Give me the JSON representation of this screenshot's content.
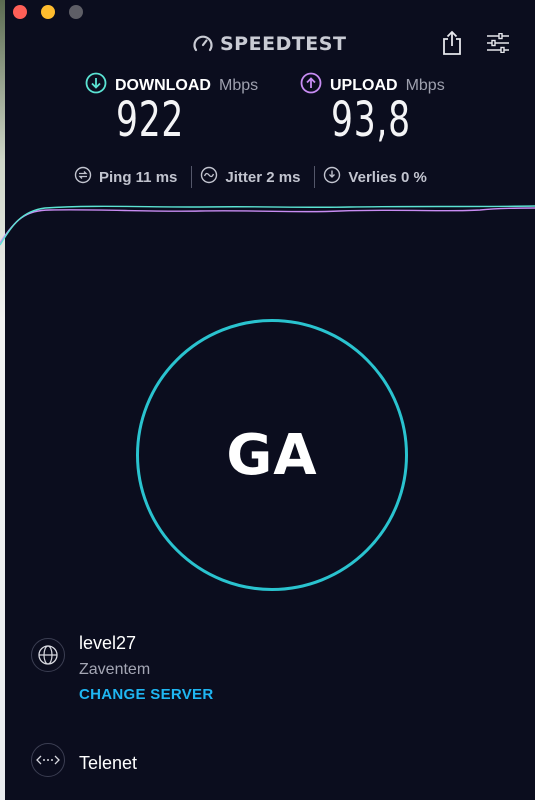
{
  "window": {
    "traffic_lights": [
      "close",
      "minimize",
      "maximize"
    ]
  },
  "header": {
    "logo_text": "SPEEDTEST",
    "logo_icon": "gauge-icon",
    "share_icon": "share-icon",
    "settings_icon": "sliders-icon"
  },
  "download": {
    "label": "DOWNLOAD",
    "unit": "Mbps",
    "value": "922",
    "icon": "arrow-down-circle-icon",
    "color": "#5be3d3"
  },
  "upload": {
    "label": "UPLOAD",
    "unit": "Mbps",
    "value": "93,8",
    "icon": "arrow-up-circle-icon",
    "color": "#c88cf3"
  },
  "stats": {
    "ping": "Ping 11 ms",
    "jitter": "Jitter 2 ms",
    "loss": "Verlies 0 %"
  },
  "go_button": {
    "label": "GA",
    "ring_color": "#2ac3cf"
  },
  "server": {
    "name": "level27",
    "location": "Zaventem",
    "change_label": "CHANGE SERVER",
    "icon": "globe-icon"
  },
  "provider": {
    "name": "Telenet",
    "icon": "connection-dots-icon"
  },
  "colors": {
    "background": "#0b0d1e",
    "accent_link": "#1fb6f2",
    "download_line": "#5be3d3",
    "upload_line": "#c88cf3"
  }
}
